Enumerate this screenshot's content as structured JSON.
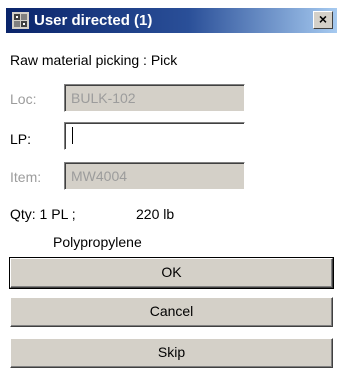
{
  "window": {
    "title": "User directed (1)",
    "close_glyph": "×",
    "icon": "scanner-app-icon"
  },
  "form": {
    "subtitle": "Raw material picking : Pick",
    "loc": {
      "label": "Loc:",
      "value": "BULK-102"
    },
    "lp": {
      "label": "LP:",
      "value": ""
    },
    "item": {
      "label": "Item:",
      "value": "MW4004"
    },
    "qty_text": "Qty: 1 PL ;",
    "weight_text": "220 lb",
    "description": "Polypropylene"
  },
  "buttons": {
    "ok": "OK",
    "cancel": "Cancel",
    "skip": "Skip"
  },
  "colors": {
    "titlebar": "#0a246a",
    "face": "#d4d0c8",
    "disabled_text": "#9c9c9c"
  }
}
